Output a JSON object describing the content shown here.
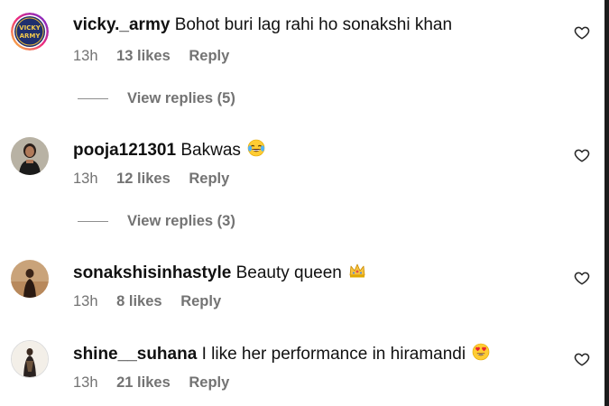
{
  "comments": [
    {
      "username": "vicky._army",
      "text": "Bohot buri lag rahi ho sonakshi khan",
      "emoji": "",
      "time": "13h",
      "likes": "13 likes",
      "reply": "Reply",
      "view_replies": "View replies (5)",
      "avatar_text_top": "VICKY",
      "avatar_text_bottom": "ARMY"
    },
    {
      "username": "pooja121301",
      "text": "Bakwas",
      "emoji": "face-with-tears-of-joy-emoji",
      "time": "13h",
      "likes": "12 likes",
      "reply": "Reply",
      "view_replies": "View replies (3)"
    },
    {
      "username": "sonakshisinhastyle",
      "text": "Beauty queen",
      "emoji": "crown-emoji",
      "time": "13h",
      "likes": "8 likes",
      "reply": "Reply"
    },
    {
      "username": "shine__suhana",
      "text": "I like her performance in hiramandi",
      "emoji": "heart-eyes-emoji",
      "time": "13h",
      "likes": "21 likes",
      "reply": "Reply"
    }
  ],
  "colors": {
    "meta_gray": "#737373",
    "username": "#111111",
    "avatar_ring_gradient": [
      "#f9ce34",
      "#ee2a7b",
      "#6228d7"
    ]
  }
}
